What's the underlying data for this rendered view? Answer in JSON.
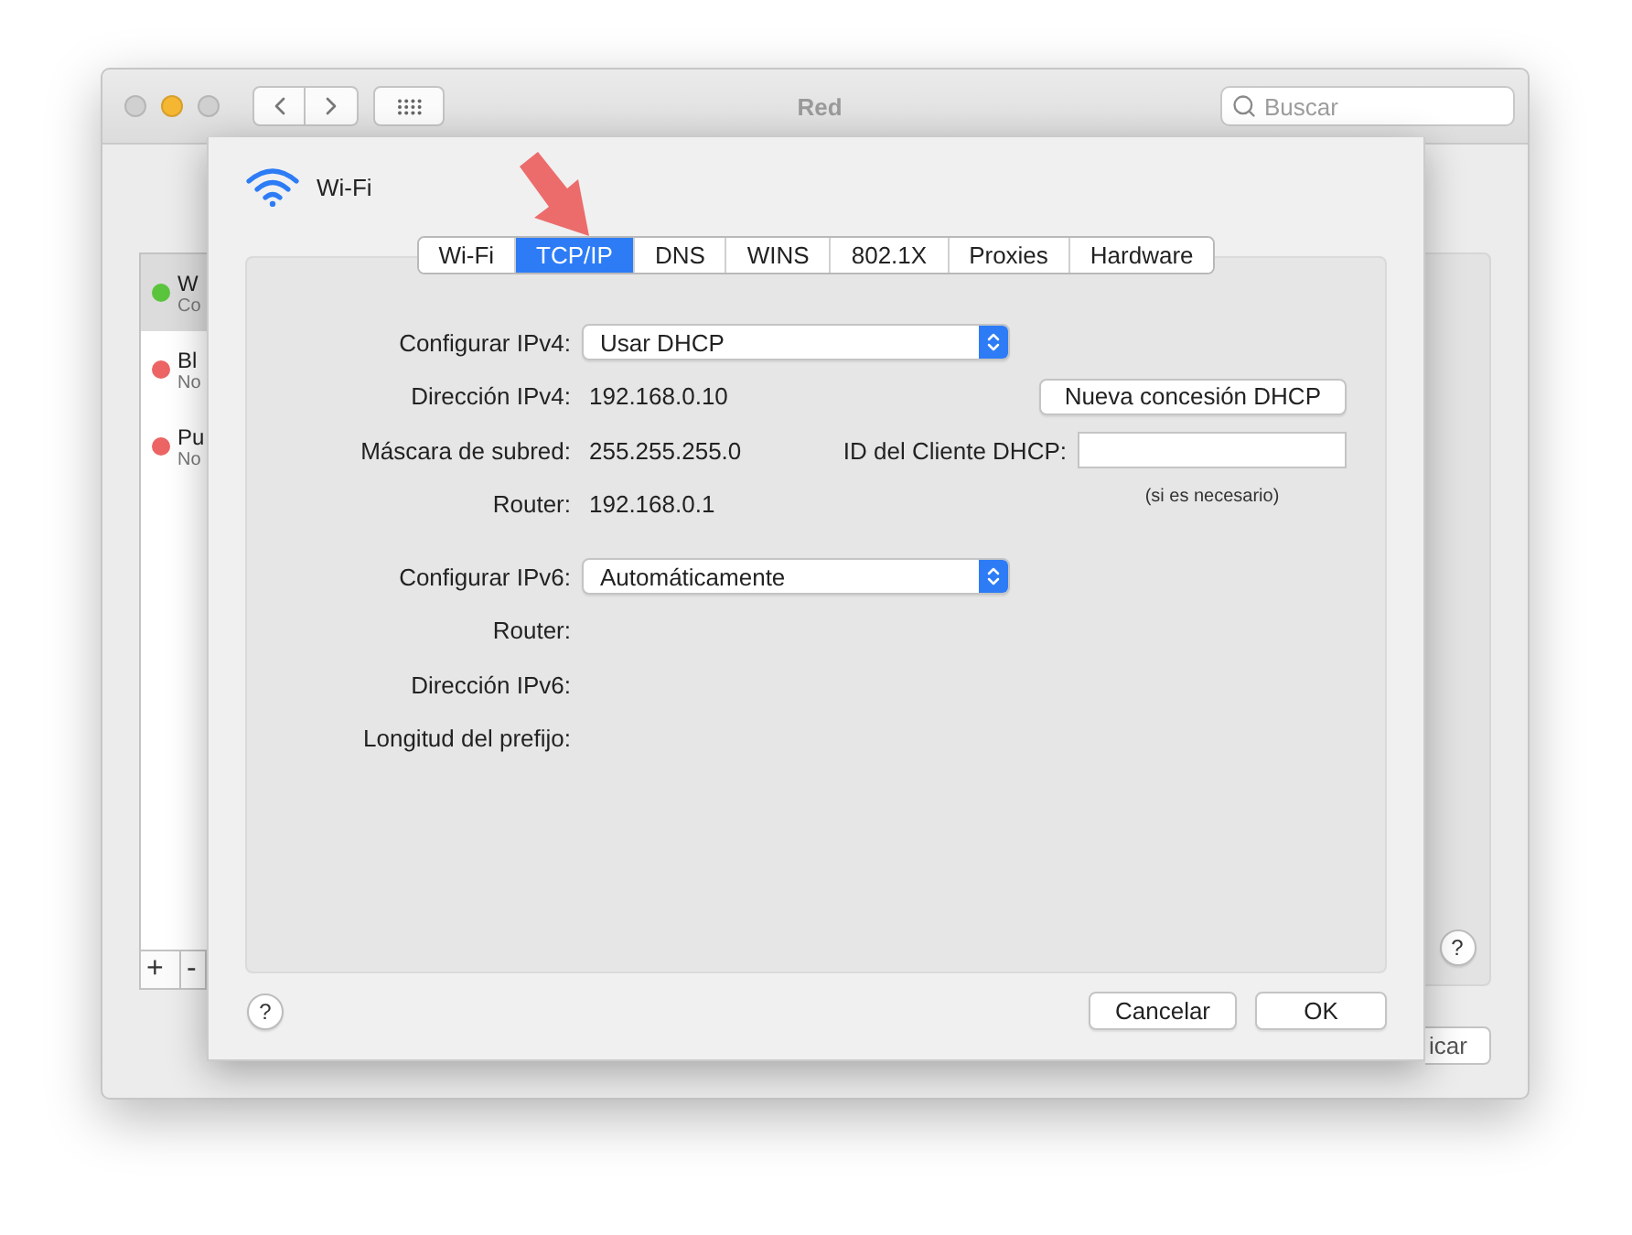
{
  "window": {
    "title": "Red",
    "search": {
      "placeholder": "Buscar"
    }
  },
  "sidebar": {
    "items": [
      {
        "name": "W",
        "status": "Co",
        "color": "#5ac43d",
        "selected": true
      },
      {
        "name": "Bl",
        "status": "No",
        "color": "#ec6464",
        "selected": false
      },
      {
        "name": "Pu",
        "status": "No",
        "color": "#ec6464",
        "selected": false
      }
    ],
    "buttons": [
      "+",
      "-"
    ]
  },
  "help_button": "?",
  "apply_button": "icar",
  "sheet": {
    "title": "Wi-Fi",
    "tabs": [
      {
        "label": "Wi-Fi",
        "selected": false
      },
      {
        "label": "TCP/IP",
        "selected": true
      },
      {
        "label": "DNS",
        "selected": false
      },
      {
        "label": "WINS",
        "selected": false
      },
      {
        "label": "802.1X",
        "selected": false
      },
      {
        "label": "Proxies",
        "selected": false
      },
      {
        "label": "Hardware",
        "selected": false
      }
    ],
    "ipv4": [
      {
        "kind": "popup",
        "label": "Configurar IPv4:",
        "value": "Usar DHCP"
      },
      {
        "kind": "text",
        "label": "Dirección IPv4:",
        "value": "192.168.0.10"
      },
      {
        "kind": "text",
        "label": "Máscara de subred:",
        "value": "255.255.255.0"
      },
      {
        "kind": "text",
        "label": "Router:",
        "value": "192.168.0.1"
      }
    ],
    "renew_button": "Nueva concesión DHCP",
    "client_id": {
      "label": "ID del Cliente DHCP:",
      "hint": "(si es necesario)"
    },
    "ipv6": [
      {
        "kind": "popup",
        "label": "Configurar IPv6:",
        "value": "Automáticamente"
      },
      {
        "kind": "text",
        "label": "Router:"
      },
      {
        "kind": "text",
        "label": "Dirección IPv6:"
      },
      {
        "kind": "text",
        "label": "Longitud del prefijo:"
      }
    ],
    "help_button": "?",
    "buttons": [
      "Cancelar",
      "OK"
    ]
  }
}
